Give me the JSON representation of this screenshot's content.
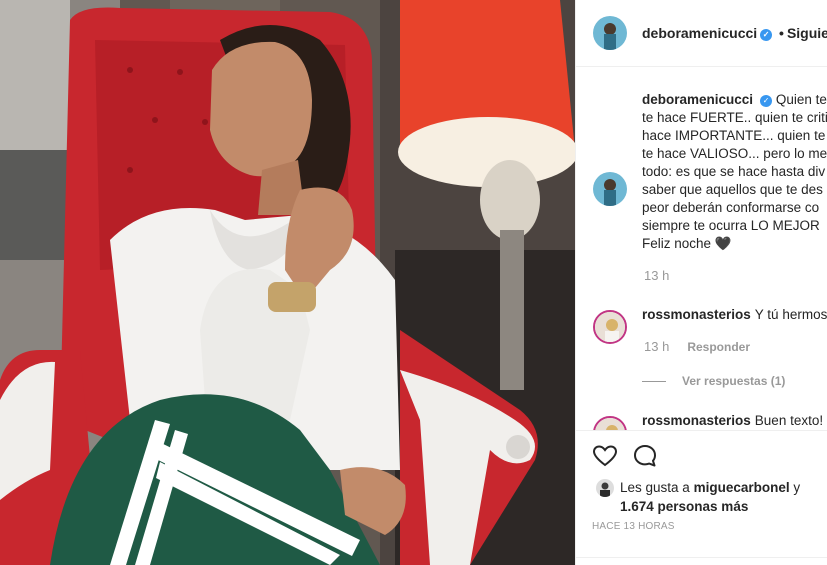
{
  "post": {
    "username": "deboramenicucci",
    "follow_label": "Siguiendo",
    "separator": "•"
  },
  "caption": {
    "username": "deboramenicucci",
    "lines": [
      "Quien te",
      "te hace FUERTE.. quien te critic",
      "hace IMPORTANTE... quien te",
      "te hace VALIOSO... pero lo me",
      "todo: es que se hace hasta div",
      "saber que aquellos que te des",
      "peor deberán conformarse co",
      "siempre te ocurra LO MEJOR",
      "Feliz noche 🖤"
    ],
    "time": "13 h"
  },
  "comment1": {
    "username": "rossmonasterios",
    "text": "Y tú hermosa",
    "time": "13 h",
    "reply_label": "Responder"
  },
  "view_replies": "Ver respuestas (1)",
  "comment2": {
    "username": "rossmonasterios",
    "text": "Buen texto!"
  },
  "likes": {
    "prefix": "Les gusta a",
    "user": "miguecarbonel",
    "conj": "y",
    "count": "1.674 personas más"
  },
  "posted": "HACE 13 HORAS",
  "icons": {
    "like": "heart-icon",
    "comment": "comment-bubble-icon",
    "verified": "verified-badge-icon"
  },
  "colors": {
    "verified": "#3897f0",
    "chair": "#c8272e",
    "lamp": "#e8432b",
    "jacket": "#f3f2f0",
    "pants": "#1f5a45"
  }
}
